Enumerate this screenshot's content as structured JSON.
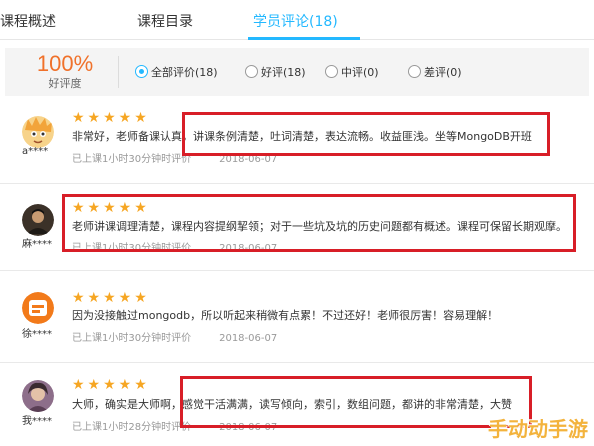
{
  "tabs": [
    {
      "label": "课程概述"
    },
    {
      "label": "课程目录"
    },
    {
      "label": "学员评论(18)",
      "active": true
    }
  ],
  "summary": {
    "score": "100%",
    "score_label": "好评度",
    "filters": [
      {
        "label": "全部评价(18)",
        "selected": true
      },
      {
        "label": "好评(18)",
        "selected": false
      },
      {
        "label": "中评(0)",
        "selected": false
      },
      {
        "label": "差评(0)",
        "selected": false
      }
    ]
  },
  "reviews": [
    {
      "user": "a****",
      "stars": "★★★★★",
      "rating": 5,
      "text": "非常好，老师备课认真，讲课条例清楚，吐词清楚，表达流畅。收益匪浅。坐等MongoDB开班",
      "studied": "已上课1小时30分钟时评价",
      "date": "2018-06-07"
    },
    {
      "user": "麻****",
      "stars": "★★★★★",
      "rating": 5,
      "text": "老师讲课调理清楚，课程内容提纲挈领；对于一些坑及坑的历史问题都有概述。课程可保留长期观摩。",
      "studied": "已上课1小时30分钟时评价",
      "date": "2018-06-07"
    },
    {
      "user": "徐****",
      "stars": "★★★★★",
      "rating": 5,
      "text": "因为没接触过mongodb，所以听起来稍微有点累！不过还好！老师很厉害！容易理解！",
      "studied": "已上课1小时30分钟时评价",
      "date": "2018-06-07"
    },
    {
      "user": "我****",
      "stars": "★★★★★",
      "rating": 5,
      "text": "大师，确实是大师啊，感觉干活满满，读写倾向，索引，数组问题，都讲的非常清楚，大赞",
      "studied": "已上课1小时28分钟时评价",
      "date": "2018-06-07"
    }
  ],
  "watermark": "手动动手游",
  "colors": {
    "accent": "#23b8ff",
    "star": "#f6a623",
    "highlight": "#d81e27",
    "score": "#f0712a"
  }
}
